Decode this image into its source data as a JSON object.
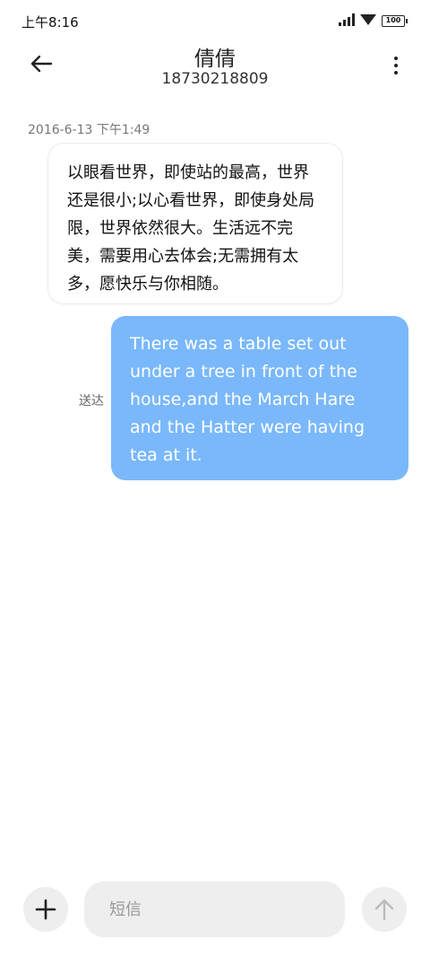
{
  "status_bar": {
    "time": "上午8:16",
    "battery": "100",
    "icons": [
      "signal-icon",
      "wifi-icon",
      "battery-icon"
    ]
  },
  "header": {
    "contact_name": "倩倩",
    "contact_number": "18730218809",
    "back_icon": "arrow-left-icon",
    "more_icon": "more-vertical-icon"
  },
  "conversation": {
    "timestamp": "2016-6-13 下午1:49",
    "incoming_message": "以眼看世界，即使站的最高，世界还是很小;以心看世界，即使身处局限，世界依然很大。生活远不完美，需要用心去体会;无需拥有太多，愿快乐与你相随。",
    "outgoing_message": "There was a table set out under a tree in front of the house,and the March Hare and the Hatter were having tea at it.",
    "outgoing_status": "送达"
  },
  "composer": {
    "placeholder": "短信",
    "add_icon": "plus-icon",
    "send_icon": "arrow-up-icon"
  },
  "colors": {
    "outgoing_bubble": "#7ab8fb",
    "button_bg": "#eeeeee"
  }
}
